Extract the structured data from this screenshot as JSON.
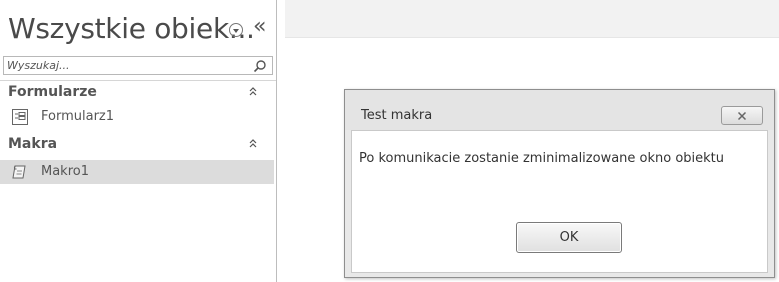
{
  "nav": {
    "title": "Wszystkie obiek...",
    "search_placeholder": "Wyszukaj...",
    "groups": [
      {
        "label": "Formularze",
        "items": [
          {
            "label": "Formularz1",
            "icon": "form-icon"
          }
        ]
      },
      {
        "label": "Makra",
        "items": [
          {
            "label": "Makro1",
            "icon": "macro-icon",
            "selected": true
          }
        ]
      }
    ]
  },
  "dialog": {
    "title": "Test makra",
    "message": "Po komunikacie zostanie zminimalizowane okno obiektu",
    "ok_label": "OK"
  }
}
